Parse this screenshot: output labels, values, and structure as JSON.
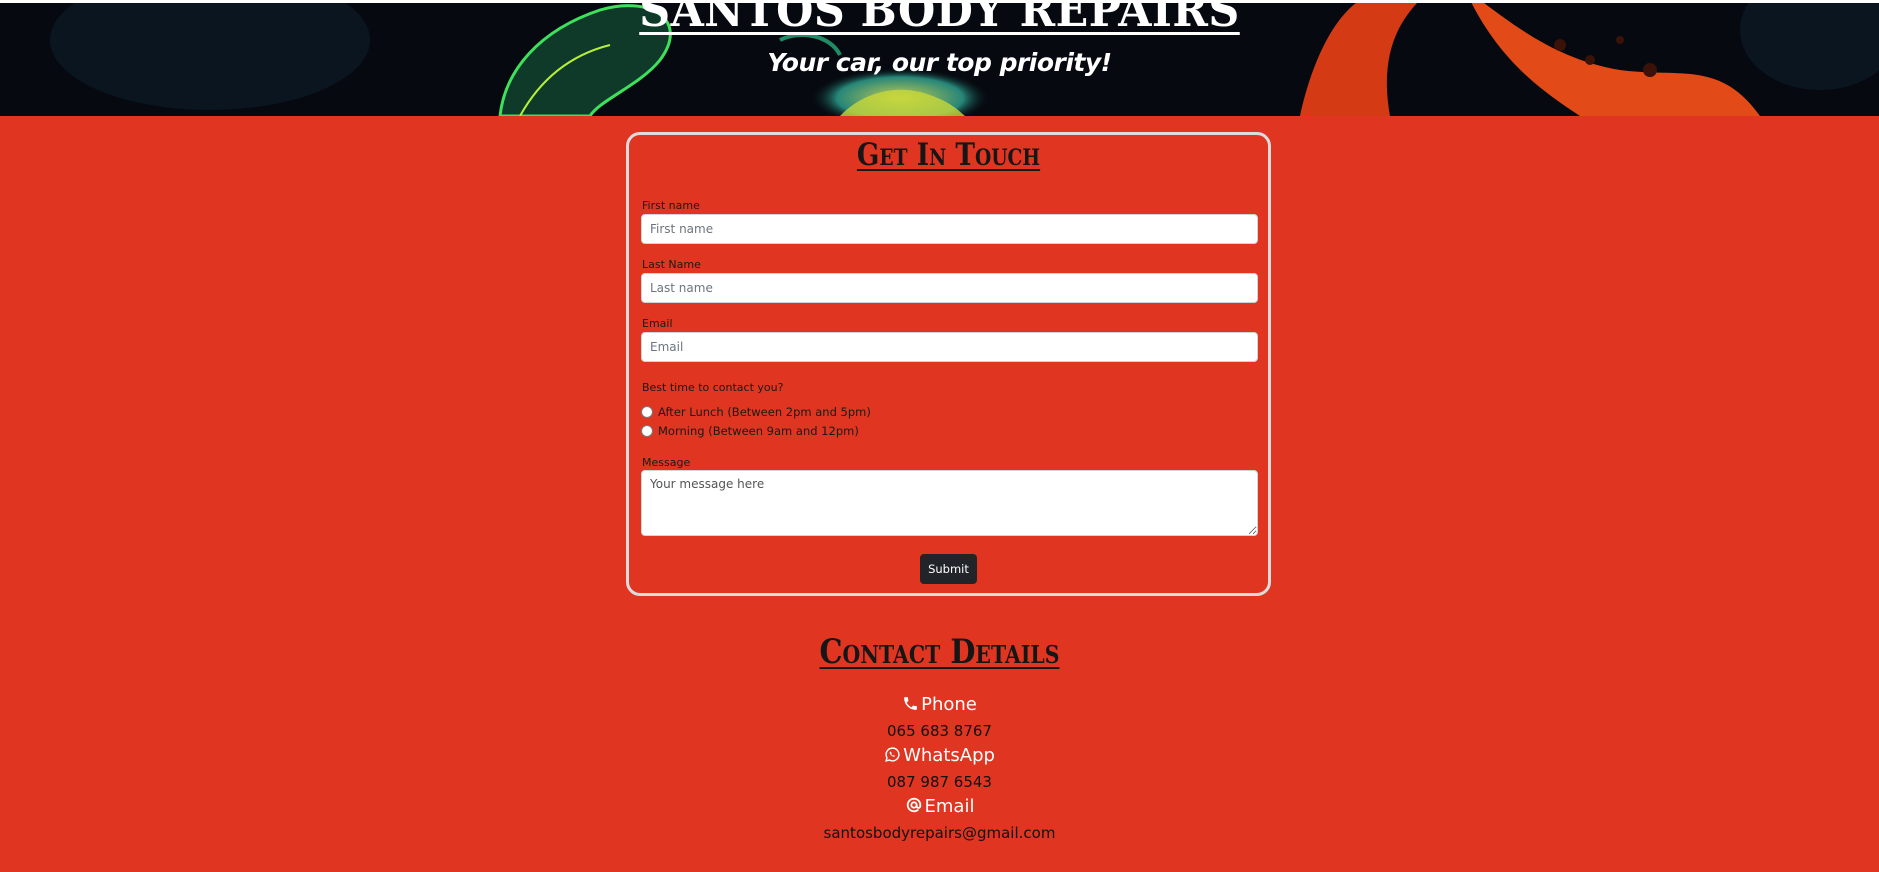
{
  "hero": {
    "title": "SANTOS BODY REPAIRS",
    "tagline": "Your car, our top priority!"
  },
  "form": {
    "heading": "Get In Touch",
    "first_name": {
      "label": "First name",
      "placeholder": "First name"
    },
    "last_name": {
      "label": "Last Name",
      "placeholder": "Last name"
    },
    "email": {
      "label": "Email",
      "placeholder": "Email"
    },
    "contact_time": {
      "label": "Best time to contact you?",
      "options": [
        "After Lunch (Between 2pm and 5pm)",
        "Morning (Between 9am and 12pm)"
      ]
    },
    "message": {
      "label": "Message",
      "placeholder": "Your message here"
    },
    "submit_label": "Submit"
  },
  "contact": {
    "heading": "Contact Details",
    "phone": {
      "label": "Phone",
      "icon": "phone-icon",
      "value": "065 683 8767"
    },
    "whatsapp": {
      "label": "WhatsApp",
      "icon": "whatsapp-icon",
      "value": "087 987 6543"
    },
    "email": {
      "label": "Email",
      "icon": "at-icon",
      "value": "santosbodyrepairs@gmail.com"
    }
  },
  "colors": {
    "page_background": "#e03520",
    "hero_background": "#05080d",
    "button": "#212529",
    "card_border": "#dcdcdc"
  }
}
